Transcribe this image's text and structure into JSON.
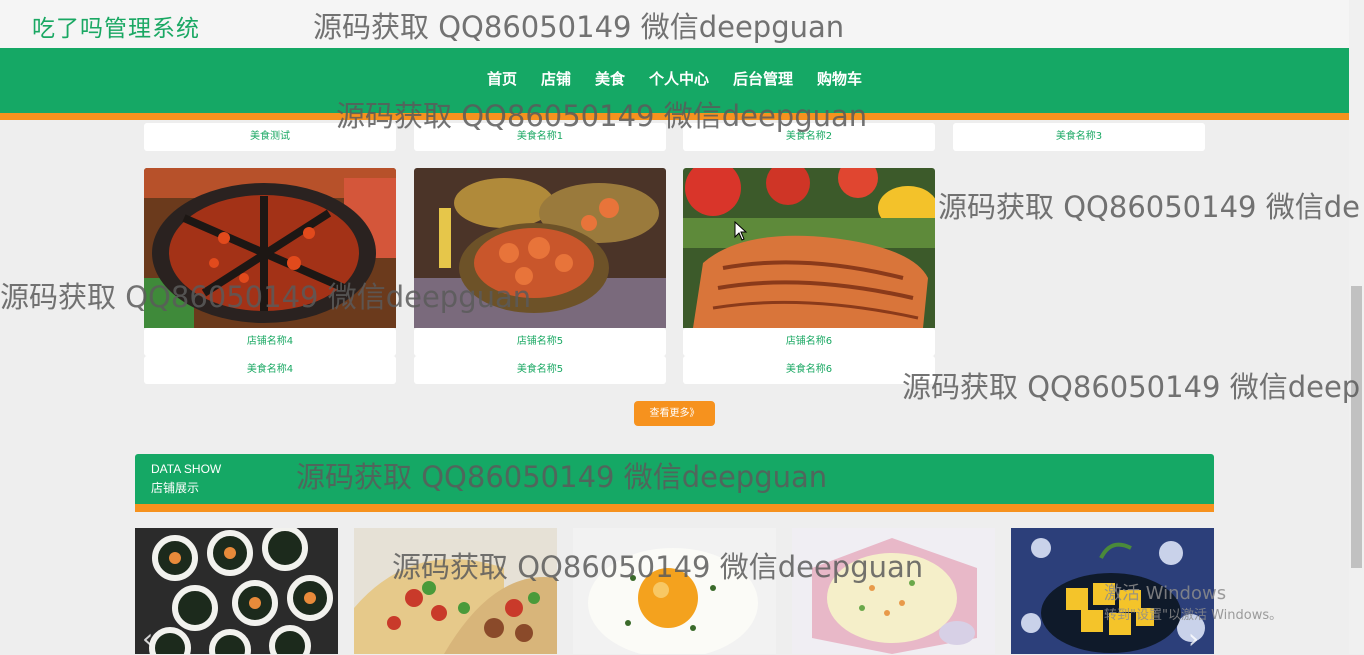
{
  "brand": {
    "title": "吃了吗管理系统"
  },
  "nav": {
    "items": [
      "首页",
      "店铺",
      "美食",
      "个人中心",
      "后台管理",
      "购物车"
    ]
  },
  "top_row_captions": [
    "美食测试",
    "美食名称1",
    "美食名称2",
    "美食名称3"
  ],
  "grid_cards": [
    {
      "shop": "店铺名称4",
      "food": "美食名称4",
      "image": "hotpot"
    },
    {
      "shop": "店铺名称5",
      "food": "美食名称5",
      "image": "seafood-platter"
    },
    {
      "shop": "店铺名称6",
      "food": "美食名称6",
      "image": "grilled-salmon"
    }
  ],
  "more_button": {
    "label": "查看更多》"
  },
  "section": {
    "en": "DATA SHOW",
    "zh": "店铺展示"
  },
  "shop_thumbs": [
    "sushi",
    "tacos",
    "fried-egg",
    "rice-bowl",
    "mango-dessert"
  ],
  "watermark": {
    "text": "源码获取 QQ86050149 微信deepguan",
    "truncated_1": "源码获取 QQ86050149 微信de",
    "truncated_2": "源码获取 QQ86050149 微信deep",
    "truncated_3": "源码获取 QQ86050149 微信deepguan"
  },
  "windows_activation": {
    "line1": "激活 Windows",
    "line2": "转到\"设置\"以激活 Windows。"
  },
  "colors": {
    "green": "#15a865",
    "orange": "#f6921e",
    "brand_text": "#1aa863"
  }
}
